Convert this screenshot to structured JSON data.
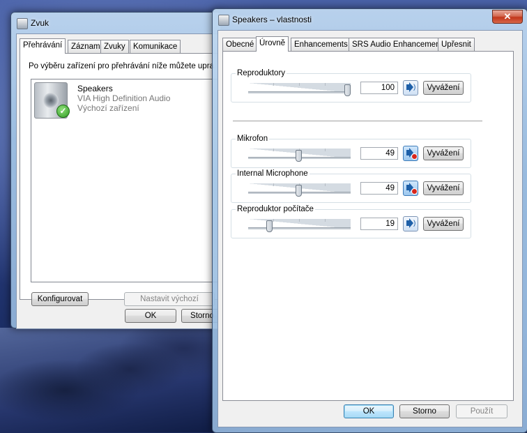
{
  "sound_window": {
    "title": "Zvuk",
    "tabs": [
      "Přehrávání",
      "Záznam",
      "Zvuky",
      "Komunikace"
    ],
    "instruction": "Po výběru zařízení pro přehrávání níže můžete upra",
    "device": {
      "name": "Speakers",
      "driver": "VIA High Definition Audio",
      "status": "Výchozí zařízení"
    },
    "configure_label": "Konfigurovat",
    "set_default_label": "Nastavit výchozí",
    "ok_label": "OK",
    "cancel_label": "Storno"
  },
  "props_window": {
    "title": "Speakers – vlastnosti",
    "close_label": "✕",
    "tabs": [
      "Obecné",
      "Úrovně",
      "Enhancements",
      "SRS Audio Enhancement",
      "Upřesnit"
    ],
    "levels": [
      {
        "label": "Reproduktory",
        "value": "100",
        "level": 1.0,
        "muted": false,
        "balance_label": "Vyvážení"
      },
      {
        "label": "Mikrofon",
        "value": "49",
        "level": 0.49,
        "muted": true,
        "balance_label": "Vyvážení"
      },
      {
        "label": "Internal Microphone",
        "value": "49",
        "level": 0.49,
        "muted": true,
        "balance_label": "Vyvážení"
      },
      {
        "label": "Reproduktor počítače",
        "value": "19",
        "level": 0.19,
        "muted": false,
        "balance_label": "Vyvážení"
      }
    ],
    "ok_label": "OK",
    "cancel_label": "Storno",
    "apply_label": "Použít"
  }
}
